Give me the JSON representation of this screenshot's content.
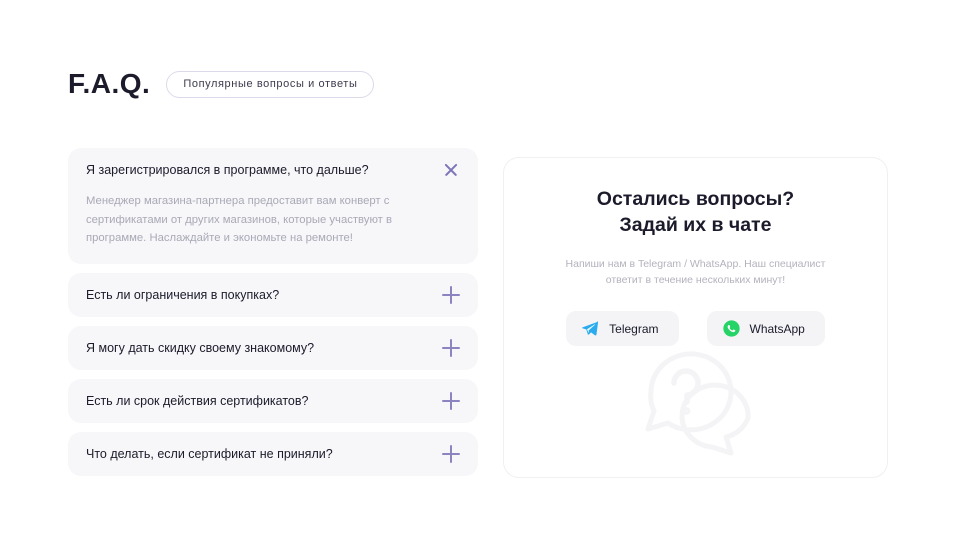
{
  "header": {
    "title": "F.A.Q.",
    "badge": "Популярные вопросы и ответы"
  },
  "accordion": {
    "items": [
      {
        "question": "Я зарегистрировался в программе, что дальше?",
        "answer": "Менеджер магазина-партнера предоставит вам конверт с сертификатами от других магазинов, которые участвуют в программе. Наслаждайте и экономьте на ремонте!",
        "state": "open",
        "icon": "close-icon"
      },
      {
        "question": "Есть ли ограничения в покупках?",
        "answer": "",
        "state": "collapsed",
        "icon": "plus-icon"
      },
      {
        "question": "Я могу дать скидку своему знакомому?",
        "answer": "",
        "state": "collapsed",
        "icon": "plus-icon"
      },
      {
        "question": "Есть ли срок действия сертификатов?",
        "answer": "",
        "state": "collapsed",
        "icon": "plus-icon"
      },
      {
        "question": "Что делать, если сертификат не приняли?",
        "answer": "",
        "state": "collapsed",
        "icon": "plus-icon"
      }
    ]
  },
  "chat_panel": {
    "title_line1": "Остались вопросы?",
    "title_line2": "Задай их в чате",
    "subtitle": "Напиши нам в Telegram / WhatsApp. Наш специалист ответит в течение нескольких минут!",
    "buttons": [
      {
        "label": "Telegram",
        "icon": "telegram-icon",
        "color": "#2AABEE"
      },
      {
        "label": "WhatsApp",
        "icon": "whatsapp-icon",
        "color": "#25D366"
      }
    ],
    "decoration": "question-speech-bubbles"
  },
  "colors": {
    "page_background": "#ffffff",
    "card_background": "#f7f7fa",
    "accent_icon": "#8b84c0",
    "text_primary": "#1b1b2b",
    "text_muted": "#a9a9b6",
    "telegram": "#2AABEE",
    "whatsapp": "#25D366"
  }
}
